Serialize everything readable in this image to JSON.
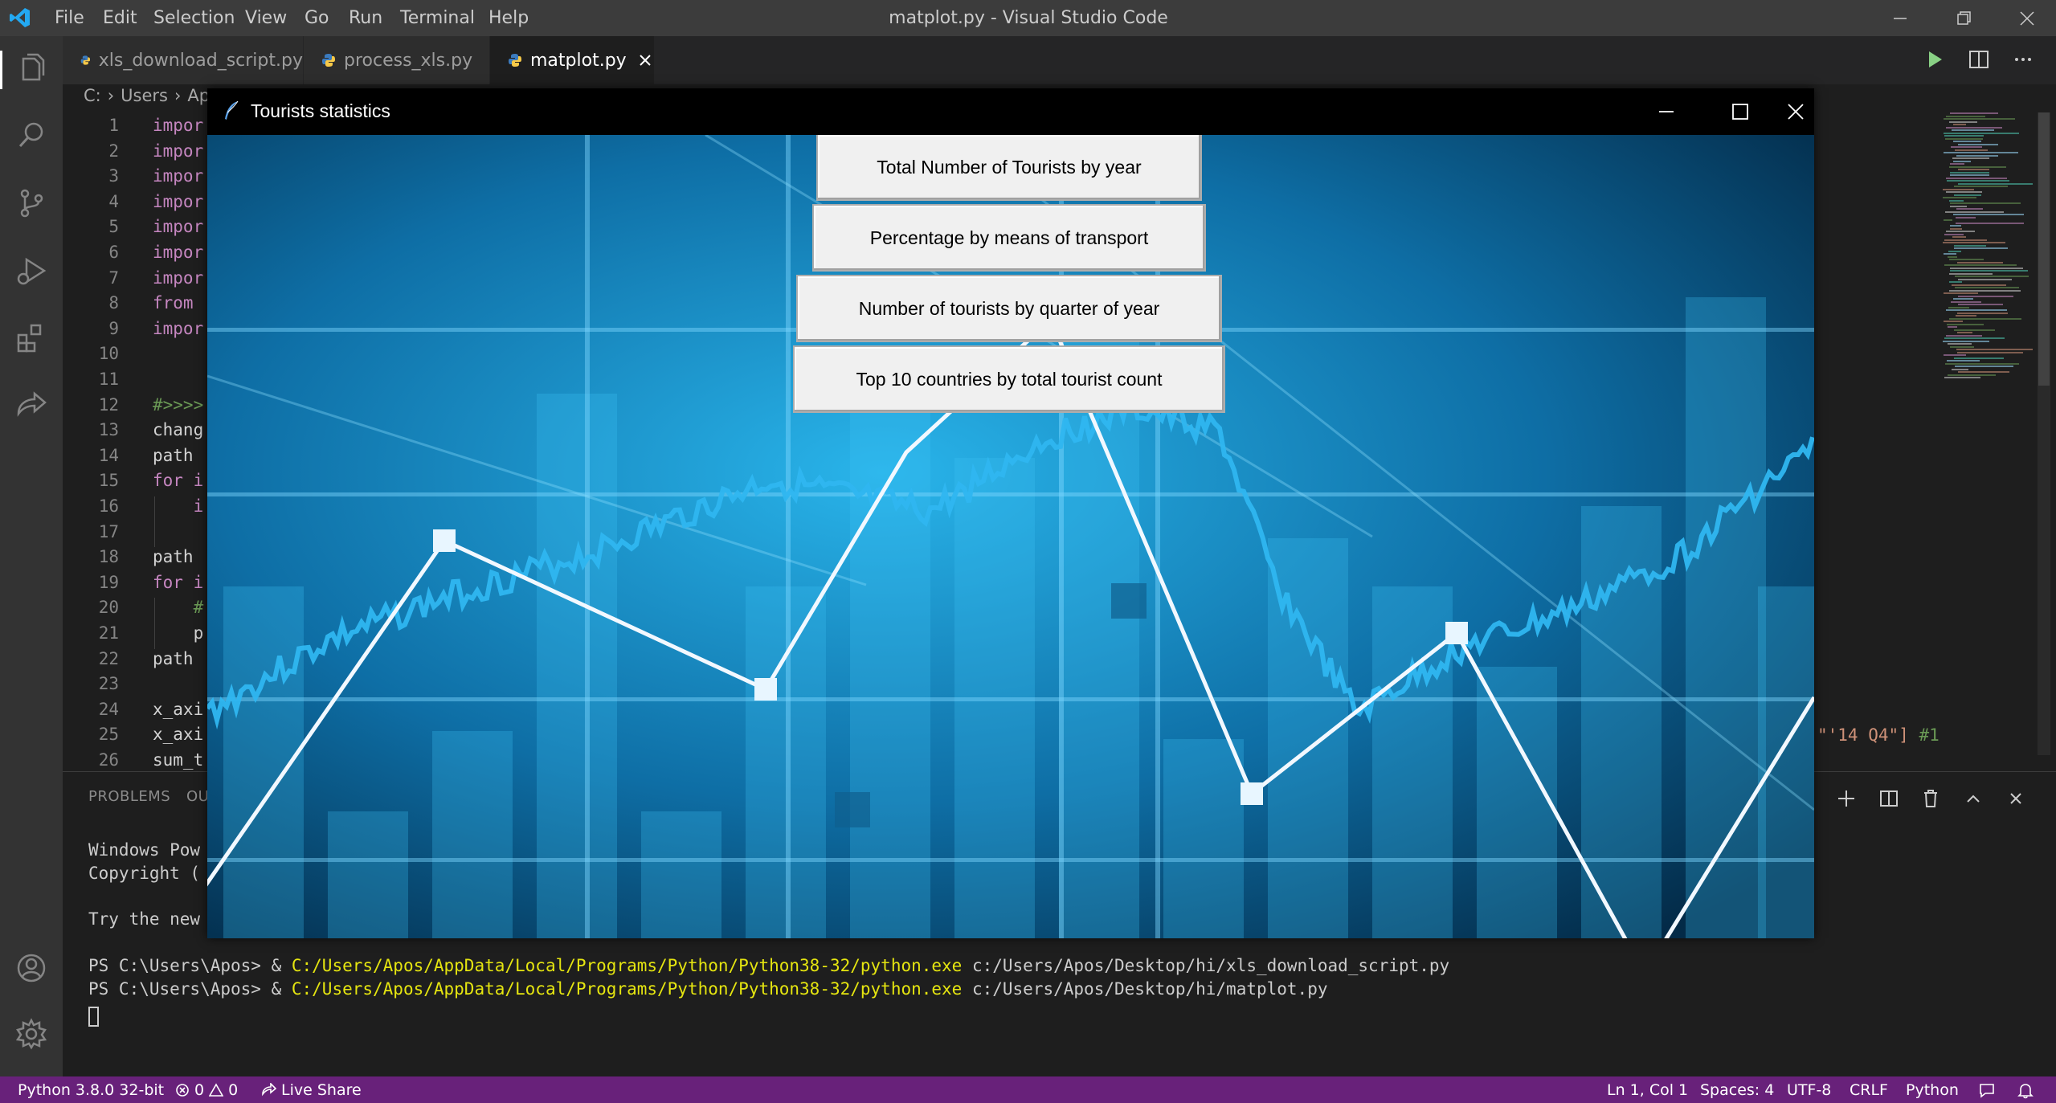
{
  "app": {
    "window_title": "matplot.py - Visual Studio Code",
    "menu": [
      "File",
      "Edit",
      "Selection",
      "View",
      "Go",
      "Run",
      "Terminal",
      "Help"
    ]
  },
  "tabs": [
    {
      "label": "xls_download_script.py",
      "active": false
    },
    {
      "label": "process_xls.py",
      "active": false
    },
    {
      "label": "matplot.py",
      "active": true
    }
  ],
  "breadcrumb": [
    "C:",
    "Users",
    "Ap"
  ],
  "editor": {
    "lines": [
      {
        "n": "1",
        "text": "impor",
        "kind": "kw"
      },
      {
        "n": "2",
        "text": "impor",
        "kind": "kw"
      },
      {
        "n": "3",
        "text": "impor",
        "kind": "kw"
      },
      {
        "n": "4",
        "text": "impor",
        "kind": "kw"
      },
      {
        "n": "5",
        "text": "impor",
        "kind": "kw"
      },
      {
        "n": "6",
        "text": "impor",
        "kind": "kw"
      },
      {
        "n": "7",
        "text": "impor",
        "kind": "kw"
      },
      {
        "n": "8",
        "text": "from",
        "kind": "kw"
      },
      {
        "n": "9",
        "text": "impor",
        "kind": "kw"
      },
      {
        "n": "10",
        "text": "",
        "kind": "id"
      },
      {
        "n": "11",
        "text": "",
        "kind": "id"
      },
      {
        "n": "12",
        "text": "#>>>>",
        "kind": "cm"
      },
      {
        "n": "13",
        "text": "chang",
        "kind": "id"
      },
      {
        "n": "14",
        "text": "path ",
        "kind": "id"
      },
      {
        "n": "15",
        "text": "for i",
        "kind": "kw"
      },
      {
        "n": "16",
        "text": "    i",
        "kind": "kw"
      },
      {
        "n": "17",
        "text": "",
        "kind": "id"
      },
      {
        "n": "18",
        "text": "path ",
        "kind": "id"
      },
      {
        "n": "19",
        "text": "for i",
        "kind": "kw"
      },
      {
        "n": "20",
        "text": "    #",
        "kind": "cm"
      },
      {
        "n": "21",
        "text": "    p",
        "kind": "id"
      },
      {
        "n": "22",
        "text": "path ",
        "kind": "id"
      },
      {
        "n": "23",
        "text": "",
        "kind": "id"
      },
      {
        "n": "24",
        "text": "x_axi",
        "kind": "id"
      },
      {
        "n": "25",
        "text": "x_axi",
        "kind": "id"
      },
      {
        "n": "26",
        "text": "sum_t",
        "kind": "id"
      }
    ],
    "tail_string": "\"'14 Q4\"]",
    "tail_comment": "#1"
  },
  "panel": {
    "tabs": [
      "PROBLEMS",
      "OU"
    ],
    "terminal": {
      "line1": "Windows Pow",
      "line2": "Copyright (",
      "line3": "Try the new",
      "prompt1": "PS C:\\Users\\Apos> & ",
      "exe": "C:/Users/Apos/AppData/Local/Programs/Python/Python38-32/python.exe",
      "script1": " c:/Users/Apos/Desktop/hi/xls_download_script.py",
      "prompt2": "PS C:\\Users\\Apos> & ",
      "script2": " c:/Users/Apos/Desktop/hi/matplot.py"
    }
  },
  "statusbar": {
    "python": "Python 3.8.0 32-bit",
    "errors": "0",
    "warnings": "0",
    "live_share": "Live Share",
    "position": "Ln 1, Col 1",
    "spaces": "Spaces: 4",
    "encoding": "UTF-8",
    "eol": "CRLF",
    "language": "Python"
  },
  "tk_window": {
    "title": "Tourists statistics",
    "buttons": [
      "Total Number of Tourists by year",
      "Percentage by means of transport",
      "Number of tourists by quarter of year",
      "Top 10 countries by total tourist count"
    ]
  },
  "colors": {
    "statusbar": "#68217a",
    "titlebar": "#3c3c3c",
    "activitybar": "#333333",
    "editor_bg": "#1e1e1e",
    "accent_blue": "#0078d4"
  },
  "icons": {
    "activity": [
      "files-icon",
      "search-icon",
      "source-control-icon",
      "run-debug-icon",
      "extensions-icon",
      "live-share-icon",
      "account-icon",
      "settings-gear-icon"
    ]
  }
}
